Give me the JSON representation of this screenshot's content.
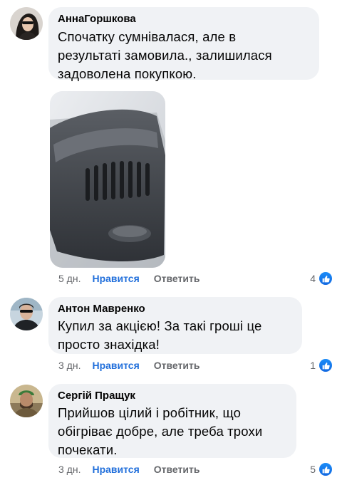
{
  "comments": [
    {
      "author": "АннаГоршкова",
      "text_lines": [
        "Спочатку сумнівалася, але в",
        "результаті замовила., залишилася",
        "задоволена покупкою."
      ],
      "time": "5 дн.",
      "like_label": "Нравится",
      "reply_label": "Ответить",
      "reactions": "4"
    },
    {
      "author": "Антон Мавренко",
      "text_lines": [
        "Купил за акцією! За такі гроші це",
        "просто знахідка!"
      ],
      "time": "3 дн.",
      "like_label": "Нравится",
      "reply_label": "Ответить",
      "reactions": "1"
    },
    {
      "author": "Сергій Пращук",
      "text_lines": [
        "Прийшов цілий і робітник, що",
        "обігріває добре, але треба трохи",
        "почекати."
      ],
      "time": "3 дн.",
      "like_label": "Нравится",
      "reply_label": "Ответить",
      "reactions": "5"
    }
  ],
  "icons": {
    "reaction": "like-thumb-icon"
  },
  "colors": {
    "like": "#216fdb",
    "bubble": "#f0f2f5",
    "meta": "#65676b",
    "reaction": "#1877f2"
  }
}
